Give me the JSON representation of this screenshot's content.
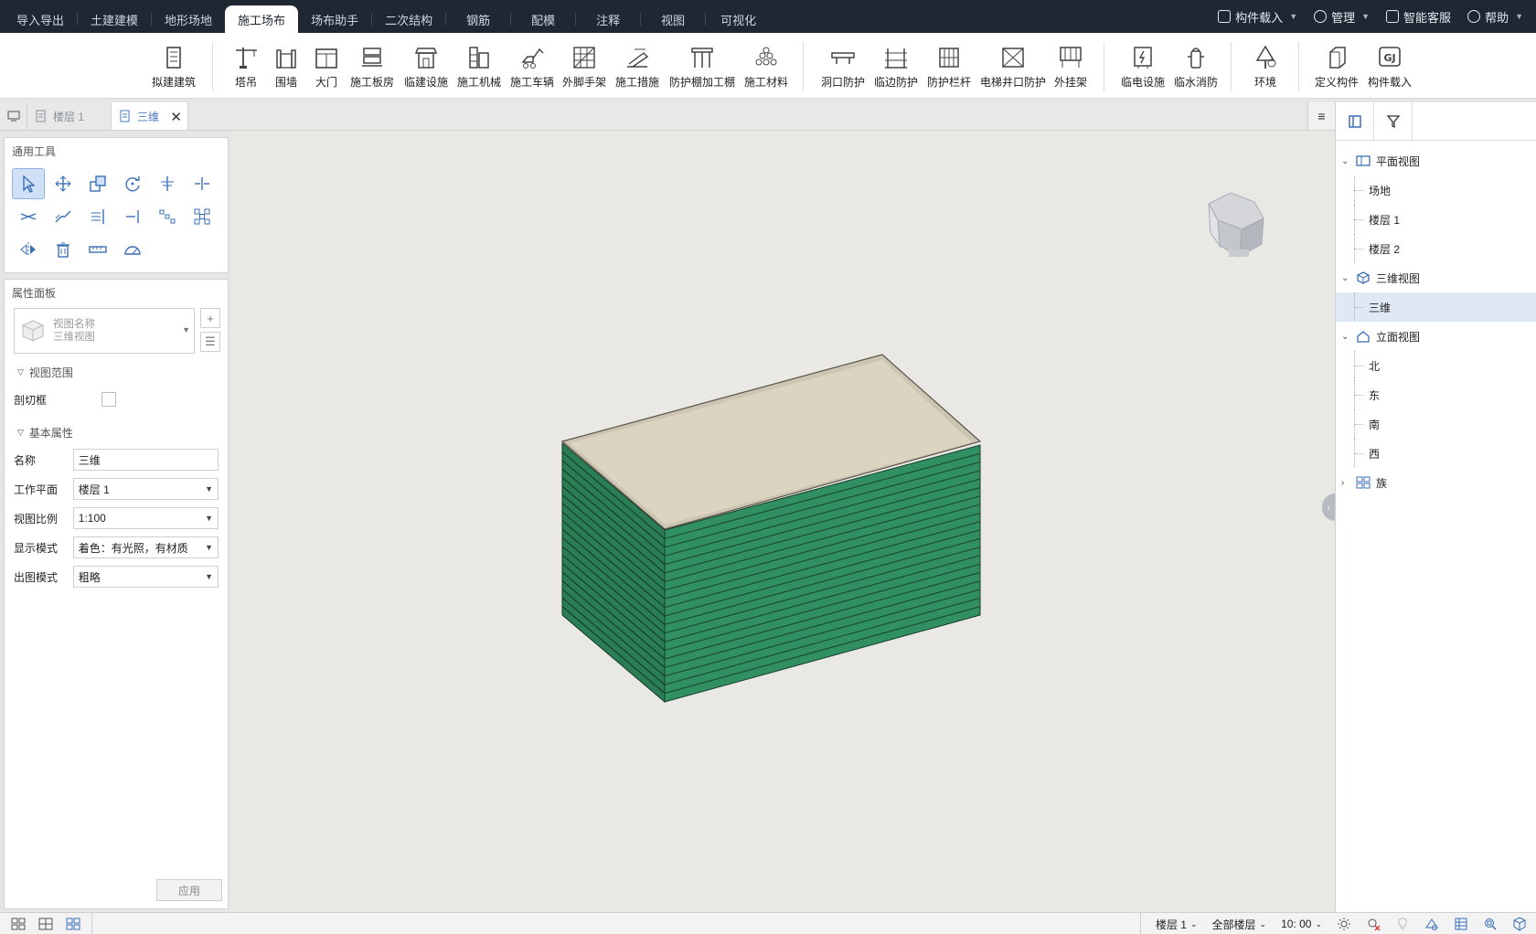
{
  "menu": {
    "tabs": [
      "导入导出",
      "土建建模",
      "地形场地",
      "施工场布",
      "场布助手",
      "二次结构",
      "钢筋",
      "配模",
      "注释",
      "视图",
      "可视化"
    ],
    "active_tab": "施工场布",
    "right": {
      "load": "构件载入",
      "manage": "管理",
      "service": "智能客服",
      "help": "帮助"
    }
  },
  "ribbon": {
    "buttons": [
      "拟建建筑",
      "塔吊",
      "围墙",
      "大门",
      "施工板房",
      "临建设施",
      "施工机械",
      "施工车辆",
      "外脚手架",
      "施工措施",
      "防护棚加工棚",
      "施工材料",
      "洞口防护",
      "临边防护",
      "防护栏杆",
      "电梯井口防护",
      "外挂架",
      "临电设施",
      "临水消防",
      "环境",
      "定义构件",
      "构件载入"
    ]
  },
  "doc_tabs": {
    "tab1": "楼层 1",
    "tab2": "三维"
  },
  "tools_panel": {
    "title": "通用工具"
  },
  "props": {
    "title": "属性面板",
    "view_name_label": "视图名称",
    "view_name_value": "三维视图",
    "section_range": "视图范围",
    "section_box_label": "剖切框",
    "section_basic": "基本属性",
    "name_label": "名称",
    "name_value": "三维",
    "workplane_label": "工作平面",
    "workplane_value": "楼层 1",
    "scale_label": "视图比例",
    "scale_value": "1:100",
    "display_label": "显示模式",
    "display_value": "着色：有光照，有材质",
    "output_label": "出图模式",
    "output_value": "粗略",
    "apply": "应用"
  },
  "tree": {
    "plan": "平面视图",
    "plan_items": [
      "场地",
      "楼层 1",
      "楼层 2"
    ],
    "three_d": "三维视图",
    "three_d_items": [
      "三维"
    ],
    "elev": "立面视图",
    "elev_items": [
      "北",
      "东",
      "南",
      "西"
    ],
    "family": "族"
  },
  "status": {
    "floor": "楼层 1",
    "all_floors": "全部楼层",
    "time": "10: 00"
  },
  "colors": {
    "facade": "#2f8a5c",
    "roof": "#d9d3c0",
    "accent": "#4a78c2"
  }
}
